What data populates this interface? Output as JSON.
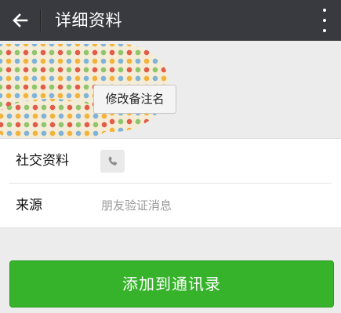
{
  "topbar": {
    "title": "详细资料",
    "back_icon": "back-arrow-icon",
    "more_icon": "more-vertical-icon",
    "background": "#393a3f"
  },
  "profile": {
    "remark_button_label": "修改备注名"
  },
  "info": {
    "rows": [
      {
        "label": "社交资料",
        "icon": "phone-icon"
      },
      {
        "label": "来源",
        "value": "朋友验证消息"
      }
    ]
  },
  "actions": {
    "add_contact_label": "添加到通讯录",
    "accent_color": "#37b22b"
  }
}
